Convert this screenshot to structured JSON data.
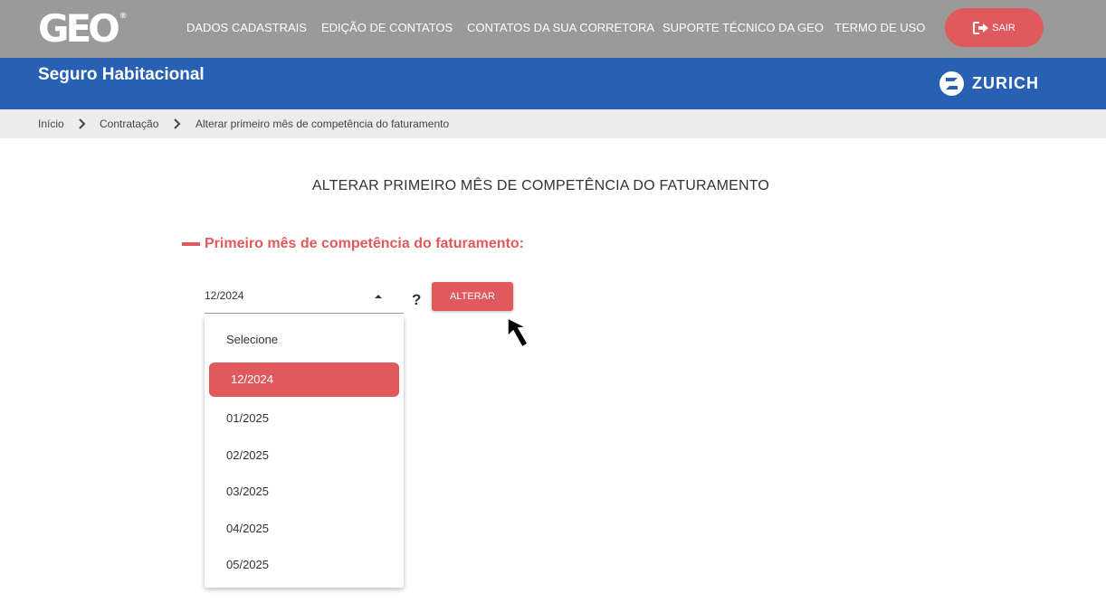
{
  "brand": {
    "logo": "GEO",
    "registered": "®"
  },
  "nav": {
    "items": [
      "DADOS CADASTRAIS",
      "EDIÇÃO DE CONTATOS",
      "CONTATOS DA SUA CORRETORA",
      "SUPORTE TÉCNICO DA GEO",
      "TERMO DE USO"
    ],
    "logout_label": "SAIR",
    "logout_icon": "logout-icon"
  },
  "header": {
    "title": "Seguro Habitacional",
    "partner_name": "ZURICH",
    "partner_icon": "zurich-logo-icon"
  },
  "breadcrumb": {
    "items": [
      "Início",
      "Contratação",
      "Alterar primeiro mês de competência do faturamento"
    ],
    "separator_icon": "chevron-right-icon"
  },
  "main": {
    "heading": "ALTERAR PRIMEIRO MÊS DE COMPETÊNCIA DO FATURAMENTO",
    "section_title": "Primeiro mês de competência do faturamento:",
    "select": {
      "value": "12/2024",
      "caret_icon": "caret-up-icon",
      "options": [
        "Selecione",
        "12/2024",
        "01/2025",
        "02/2025",
        "03/2025",
        "04/2025",
        "05/2025"
      ],
      "selected_index": 1
    },
    "help_label": "?",
    "submit_label": "ALTERAR"
  },
  "colors": {
    "topbar": "#9a9a9a",
    "band": "#2860b3",
    "accent": "#e0595c",
    "breadcrumb_bg": "#ececec"
  }
}
